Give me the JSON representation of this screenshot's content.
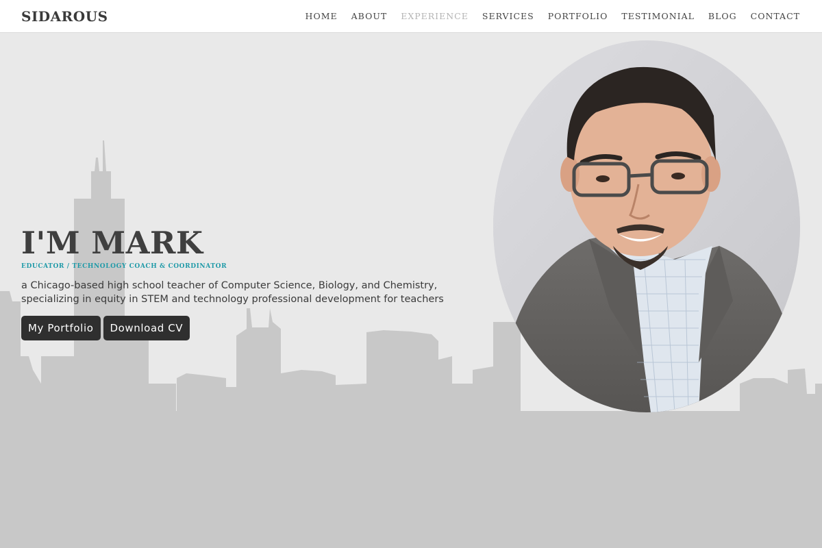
{
  "brand": "SIDAROUS",
  "nav": {
    "items": [
      {
        "label": "HOME",
        "active": false
      },
      {
        "label": "ABOUT",
        "active": false
      },
      {
        "label": "EXPERIENCE",
        "active": true
      },
      {
        "label": "SERVICES",
        "active": false
      },
      {
        "label": "PORTFOLIO",
        "active": false
      },
      {
        "label": "TESTIMONIAL",
        "active": false
      },
      {
        "label": "BLOG",
        "active": false
      },
      {
        "label": "CONTACT",
        "active": false
      }
    ]
  },
  "hero": {
    "title": "I'M MARK",
    "subtitle": "EDUCATOR / TECHNOLOGY COACH & COORDINATOR",
    "description": "a Chicago-based high school teacher of Computer Science, Biology, and Chemistry, specializing in equity in STEM and technology professional development for teachers",
    "buttons": {
      "portfolio": "My Portfolio",
      "cv": "Download CV"
    }
  },
  "colors": {
    "accent": "#1f9aa8",
    "button_bg": "#2f2f2f",
    "page_bg": "#e9e9e9",
    "skyline": "#c8c8c8",
    "nav_active": "#b4b4b4"
  },
  "images": {
    "portrait": "portrait-photo",
    "skyline": "city-skyline-silhouette"
  }
}
